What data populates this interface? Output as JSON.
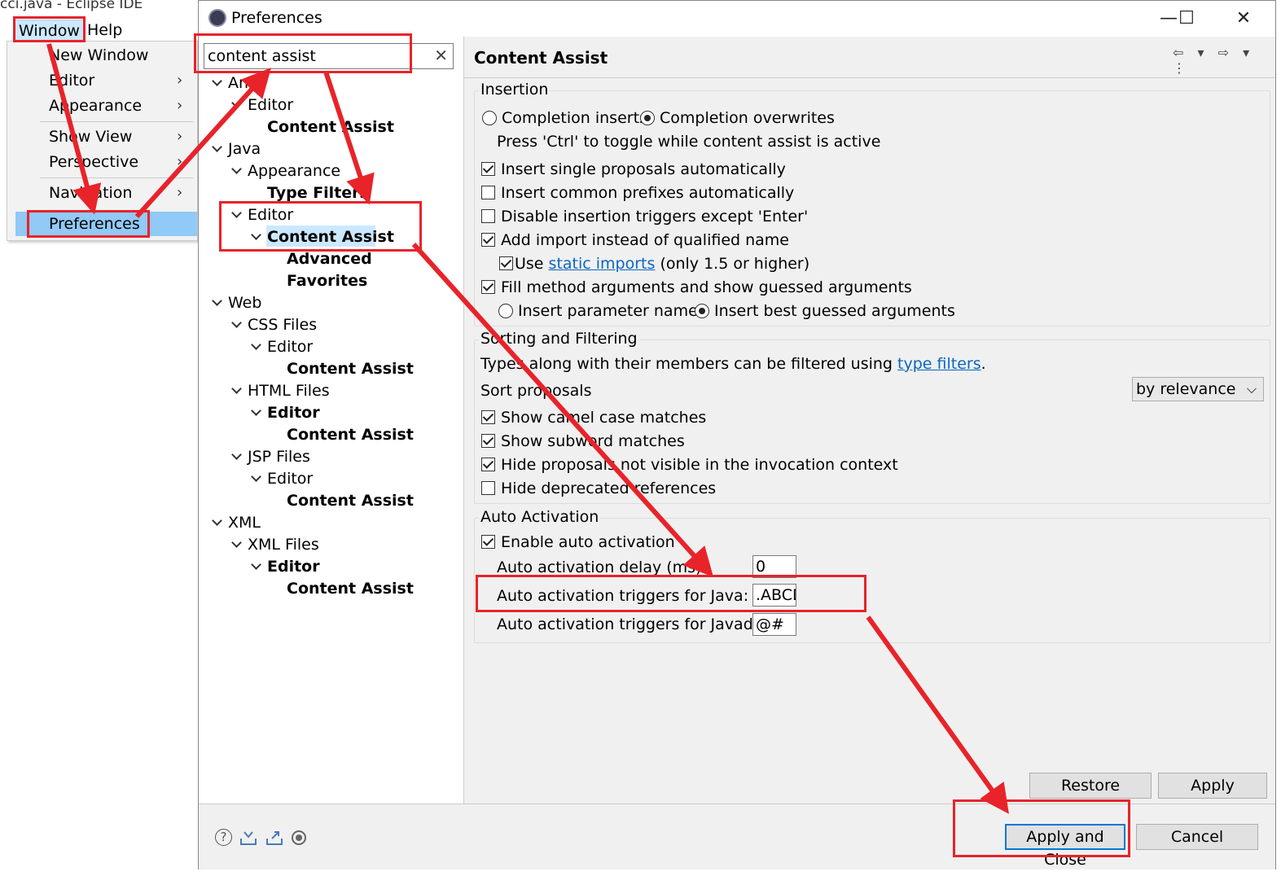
{
  "background_window": {
    "title": "cci.java - Eclipse IDE",
    "menubar": {
      "window": "Window",
      "help": "Help"
    }
  },
  "window_menu": {
    "items": [
      {
        "label": "New Window",
        "submenu": false
      },
      {
        "label": "Editor",
        "submenu": true
      },
      {
        "label": "Appearance",
        "submenu": true
      },
      {
        "label": "Show View",
        "submenu": true
      },
      {
        "label": "Perspective",
        "submenu": true
      },
      {
        "label": "Navigation",
        "submenu": true
      },
      {
        "label": "Preferences",
        "submenu": false,
        "highlighted": true
      }
    ],
    "submenu_arrow": "›"
  },
  "dialog": {
    "title": "Preferences",
    "window_buttons": {
      "minimize": "—",
      "maximize": "☐",
      "close": "✕"
    },
    "search": {
      "value": "content assist",
      "clear": "✕"
    },
    "tree": [
      {
        "label": "Ant",
        "level": 0,
        "bold": false,
        "expanded": true
      },
      {
        "label": "Editor",
        "level": 1,
        "bold": false,
        "expanded": true
      },
      {
        "label": "Content Assist",
        "level": 2,
        "bold": true
      },
      {
        "label": "Java",
        "level": 0,
        "bold": false,
        "expanded": true
      },
      {
        "label": "Appearance",
        "level": 1,
        "bold": false,
        "expanded": true
      },
      {
        "label": "Type Filters",
        "level": 2,
        "bold": true
      },
      {
        "label": "Editor",
        "level": 1,
        "bold": false,
        "expanded": true
      },
      {
        "label": "Content Assist",
        "level": 2,
        "bold": true,
        "expanded": true,
        "selected": true
      },
      {
        "label": "Advanced",
        "level": 3,
        "bold": true
      },
      {
        "label": "Favorites",
        "level": 3,
        "bold": true
      },
      {
        "label": "Web",
        "level": 0,
        "bold": false,
        "expanded": true
      },
      {
        "label": "CSS Files",
        "level": 1,
        "bold": false,
        "expanded": true
      },
      {
        "label": "Editor",
        "level": 2,
        "bold": false,
        "expanded": true
      },
      {
        "label": "Content Assist",
        "level": 3,
        "bold": true
      },
      {
        "label": "HTML Files",
        "level": 1,
        "bold": false,
        "expanded": true
      },
      {
        "label": "Editor",
        "level": 2,
        "bold": true,
        "expanded": true
      },
      {
        "label": "Content Assist",
        "level": 3,
        "bold": true
      },
      {
        "label": "JSP Files",
        "level": 1,
        "bold": false,
        "expanded": true
      },
      {
        "label": "Editor",
        "level": 2,
        "bold": false,
        "expanded": true
      },
      {
        "label": "Content Assist",
        "level": 3,
        "bold": true
      },
      {
        "label": "XML",
        "level": 0,
        "bold": false,
        "expanded": true
      },
      {
        "label": "XML Files",
        "level": 1,
        "bold": false,
        "expanded": true
      },
      {
        "label": "Editor",
        "level": 2,
        "bold": true,
        "expanded": true
      },
      {
        "label": "Content Assist",
        "level": 3,
        "bold": true
      }
    ],
    "page": {
      "title": "Content Assist",
      "tools": "⇦ ▾ ⇨ ▾ ⋮",
      "insertion": {
        "title": "Insertion",
        "completion_inserts": "Completion inserts",
        "completion_overwrites": "Completion overwrites",
        "hint": "Press 'Ctrl' to toggle while content assist is active",
        "insert_single": "Insert single proposals automatically",
        "insert_common": "Insert common prefixes automatically",
        "disable_triggers": "Disable insertion triggers except 'Enter'",
        "add_import": "Add import instead of qualified name",
        "use_prefix": "Use",
        "static_imports": "static imports",
        "use_suffix": "(only 1.5 or higher)",
        "fill_args": "Fill method arguments and show guessed arguments",
        "insert_param_names": "Insert parameter names",
        "insert_best_guessed": "Insert best guessed arguments"
      },
      "sorting": {
        "title": "Sorting and Filtering",
        "types_prefix": "Types along with their members can be filtered using",
        "type_filters": "type filters",
        "types_suffix": ".",
        "sort_label": "Sort proposals",
        "sort_value": "by relevance",
        "camel": "Show camel case matches",
        "subword": "Show subword matches",
        "hide_not_visible": "Hide proposals not visible in the invocation context",
        "hide_deprecated": "Hide deprecated references"
      },
      "auto": {
        "title": "Auto Activation",
        "enable": "Enable auto activation",
        "delay_label": "Auto activation delay (ms):",
        "delay_value": "0",
        "java_label": "Auto activation triggers for Java:",
        "java_value": ".ABCD",
        "javadoc_label": "Auto activation triggers for Javadoc:",
        "javadoc_value": "@#"
      },
      "restore_defaults": "Restore Defaults",
      "apply": "Apply"
    },
    "footer": {
      "help": "?",
      "apply_and_close": "Apply and Close",
      "cancel": "Cancel"
    }
  },
  "annotation_color": "#e8232a"
}
